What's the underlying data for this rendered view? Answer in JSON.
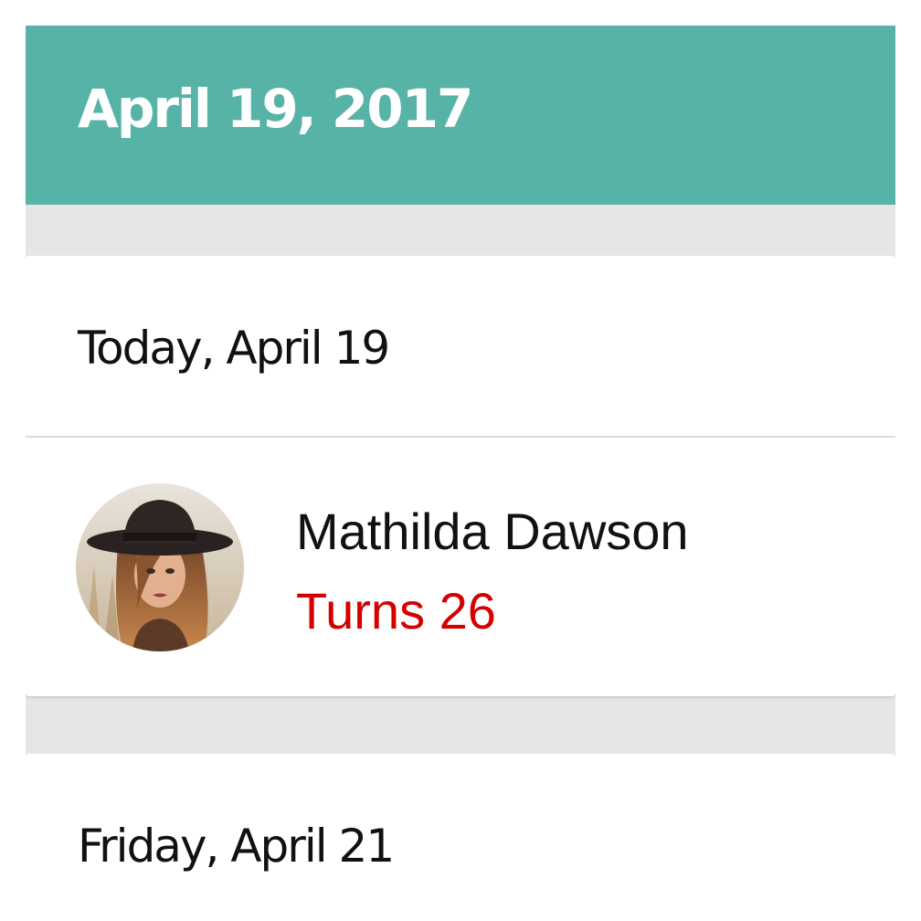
{
  "header": {
    "title": "April 19, 2017",
    "background_color": "#58b3a7"
  },
  "sections": [
    {
      "day_label": "Today, April 19",
      "people": [
        {
          "name": "Mathilda Dawson",
          "subtitle": "Turns 26",
          "subtitle_color": "#d40000",
          "avatar_icon": "avatar-photo-woman-in-hat"
        }
      ]
    },
    {
      "day_label": "Friday, April 21",
      "people": []
    }
  ]
}
